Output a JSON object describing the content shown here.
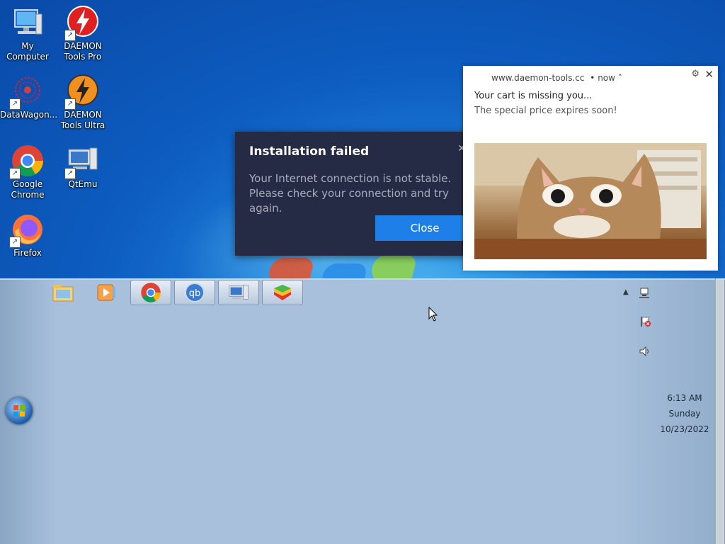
{
  "desktop": {
    "icons": [
      {
        "label": "My Computer",
        "icon": "computer-icon"
      },
      {
        "label": "DAEMON Tools Pro",
        "icon": "daemon-tools-pro-icon"
      },
      {
        "label": "DataWagon...",
        "icon": "datawagon-icon"
      },
      {
        "label": "DAEMON Tools Ultra",
        "icon": "daemon-tools-ultra-icon"
      },
      {
        "label": "Google Chrome",
        "icon": "chrome-icon"
      },
      {
        "label": "QtEmu",
        "icon": "qtemu-icon"
      },
      {
        "label": "Firefox",
        "icon": "firefox-icon"
      }
    ]
  },
  "dialog": {
    "title": "Installation failed",
    "message": "Your Internet connection is not stable. Please check your connection and try again.",
    "close_button": "Close",
    "bg_color": "#252b45",
    "button_color": "#1e7fe8"
  },
  "notification": {
    "source": "www.daemon-tools.cc",
    "time": "• now ˄",
    "line1": "Your cart is missing you...",
    "line2": "The special price expires soon!",
    "image": "cat-photo"
  },
  "taskbar": {
    "buttons": [
      {
        "icon": "file-explorer-icon",
        "active": false
      },
      {
        "icon": "media-player-icon",
        "active": false
      },
      {
        "icon": "chrome-icon",
        "active": true
      },
      {
        "icon": "qbittorrent-icon",
        "active": true
      },
      {
        "icon": "qtemu-icon",
        "active": true
      },
      {
        "icon": "bluestacks-icon",
        "active": true
      }
    ],
    "clock": {
      "time": "6:13 AM",
      "day": "Sunday",
      "date": "10/23/2022"
    }
  }
}
